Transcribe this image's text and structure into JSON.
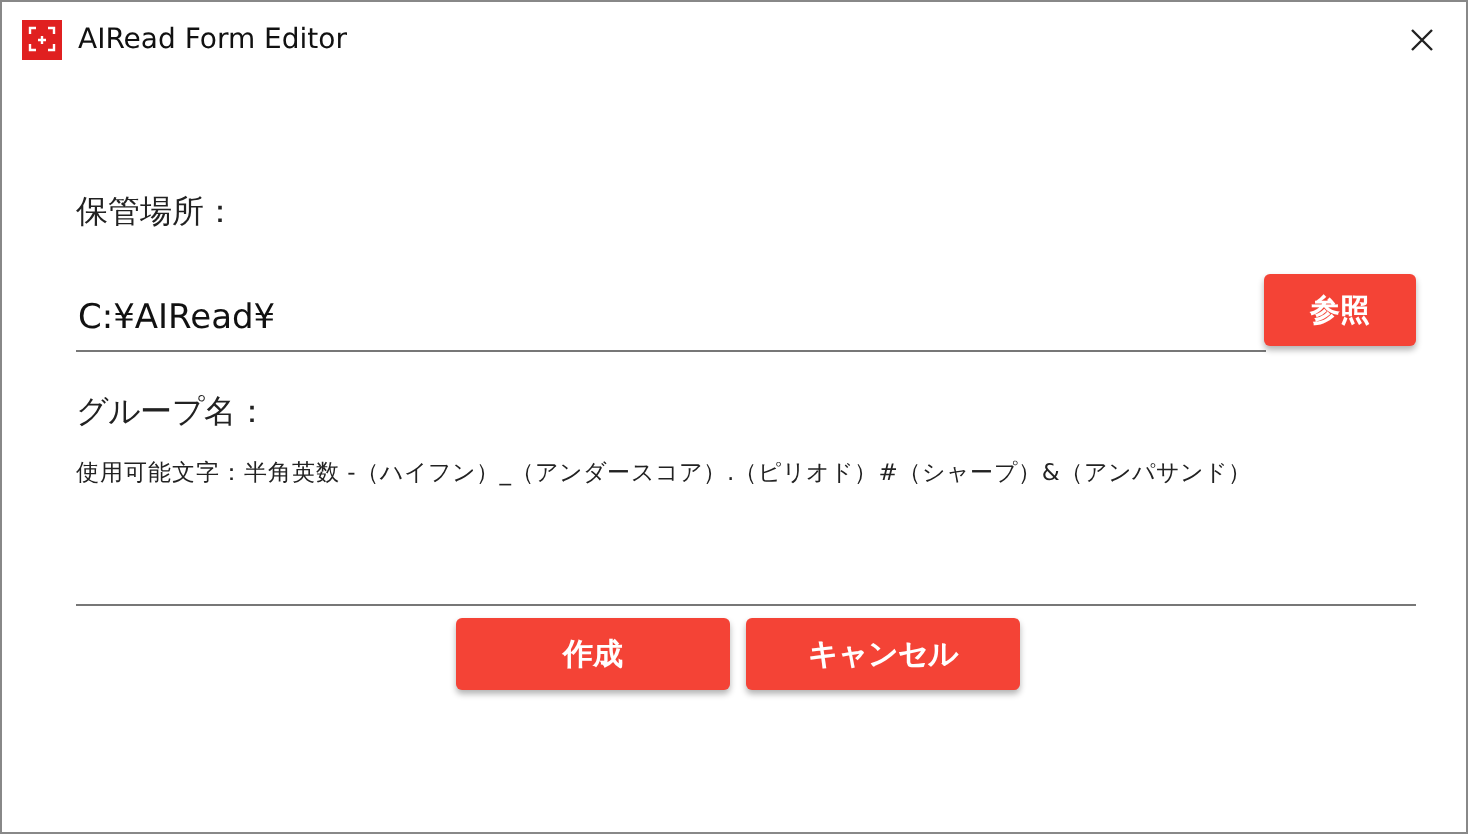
{
  "window": {
    "title": "AIRead Form Editor"
  },
  "storage": {
    "label": "保管場所：",
    "value": "C:¥AIRead¥",
    "button": "参照"
  },
  "group": {
    "label": "グループ名：",
    "hint": "使用可能文字：半角英数 -（ハイフン）_（アンダースコア）.（ピリオド）#（シャープ）&（アンパサンド）"
  },
  "buttons": [
    "作成",
    "キャンセル"
  ]
}
